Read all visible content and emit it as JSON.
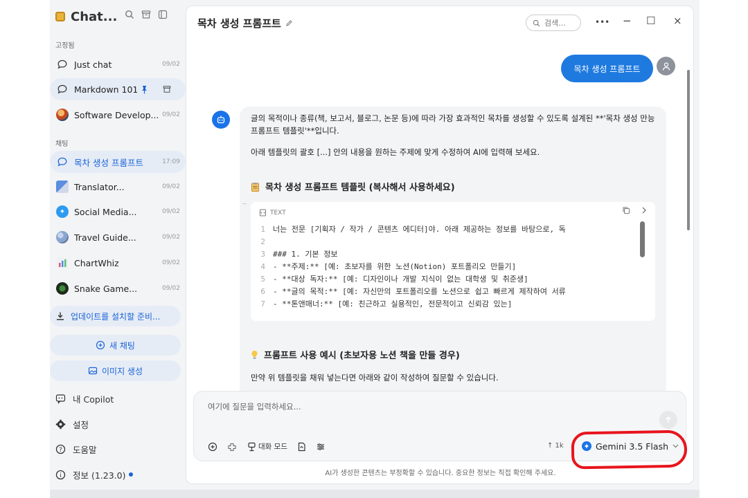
{
  "sidebar": {
    "app_title": "Chat...",
    "pinned_header": "고정됨",
    "chats_header": "채팅",
    "pinned": [
      {
        "label": "Just chat",
        "date": "09/02"
      },
      {
        "label": "Markdown 101...",
        "date": ""
      },
      {
        "label": "Software Develop...",
        "date": "09/02"
      }
    ],
    "chats": [
      {
        "label": "목차 생성 프롬프트",
        "date": "17:09"
      },
      {
        "label": "Translator...",
        "date": "09/02"
      },
      {
        "label": "Social Media...",
        "date": "09/02"
      },
      {
        "label": "Travel Guide...",
        "date": "09/02"
      },
      {
        "label": "ChartWhiz",
        "date": "09/02"
      },
      {
        "label": "Snake Game...",
        "date": "09/02"
      }
    ],
    "update_label": "업데이트를 설치할 준비...",
    "new_chat_label": "새 채팅",
    "image_gen_label": "이미지 생성",
    "nav": [
      {
        "label": "내 Copilot"
      },
      {
        "label": "설정"
      },
      {
        "label": "도움말"
      },
      {
        "label": "정보 (1.23.0)"
      }
    ]
  },
  "header": {
    "title": "목차 생성 프롬프트",
    "search_placeholder": "검색...",
    "more": "•••",
    "minimize": "−",
    "maximize": "☐",
    "close": "×"
  },
  "user_message": "목차 생성 프롬프트",
  "assistant": {
    "intro": "글의 목적이나 종류(책, 보고서, 블로그, 논문 등)에 따라 가장 효과적인 목차를 생성할 수 있도록 설계된 **'목차 생성 만능 프롬프트 템플릿'**입니다.",
    "intro2": "아래 템플릿의 괄호 [...] 안의 내용을 원하는 주제에 맞게 수정하여 AI에 입력해 보세요.",
    "template_heading": "목차 생성 프롬프트 템플릿 (복사해서 사용하세요)",
    "code_lang": "TEXT",
    "code_lines": [
      {
        "n": "1",
        "text": "너는 전문 [기획자 / 작가 / 콘텐츠 에디터]야. 아래 제공하는 정보를 바탕으로, 독"
      },
      {
        "n": "2",
        "text": ""
      },
      {
        "n": "3",
        "text": "### 1. 기본 정보"
      },
      {
        "n": "4",
        "text": "- **주제:** [예: 초보자를 위한 노션(Notion) 포트폴리오 만들기]"
      },
      {
        "n": "5",
        "text": "- **대상 독자:** [예: 디자인이나 개발 지식이 없는 대학생 및 취준생]"
      },
      {
        "n": "6",
        "text": "- **글의 목적:** [예: 자신만의 포트폴리오를 노션으로 쉽고 빠르게 제작하여 서류"
      },
      {
        "n": "7",
        "text": "- **톤앤매너:** [예: 친근하고 실용적인, 전문적이고 신뢰감 있는]"
      }
    ],
    "example_heading": "프롬프트 사용 예시 (초보자용 노션 책을 만들 경우)",
    "example_text": "만약 위 템플릿을 채워 넣는다면 아래와 같이 작성하여 질문할 수 있습니다."
  },
  "composer": {
    "placeholder": "여기에 질문을 입력하세요...",
    "mode_label": "대화 모드",
    "tokens": "↑ 1k",
    "model": "Gemini 3.5 Flash"
  },
  "footer": "AI가 생성한 콘텐츠는 부정확할 수 있습니다. 중요한 정보는 직접 확인해 주세요.",
  "colors": {
    "accent": "#1a63d6",
    "highlight": "#e8141d",
    "status_dot": "#1a63d6"
  }
}
